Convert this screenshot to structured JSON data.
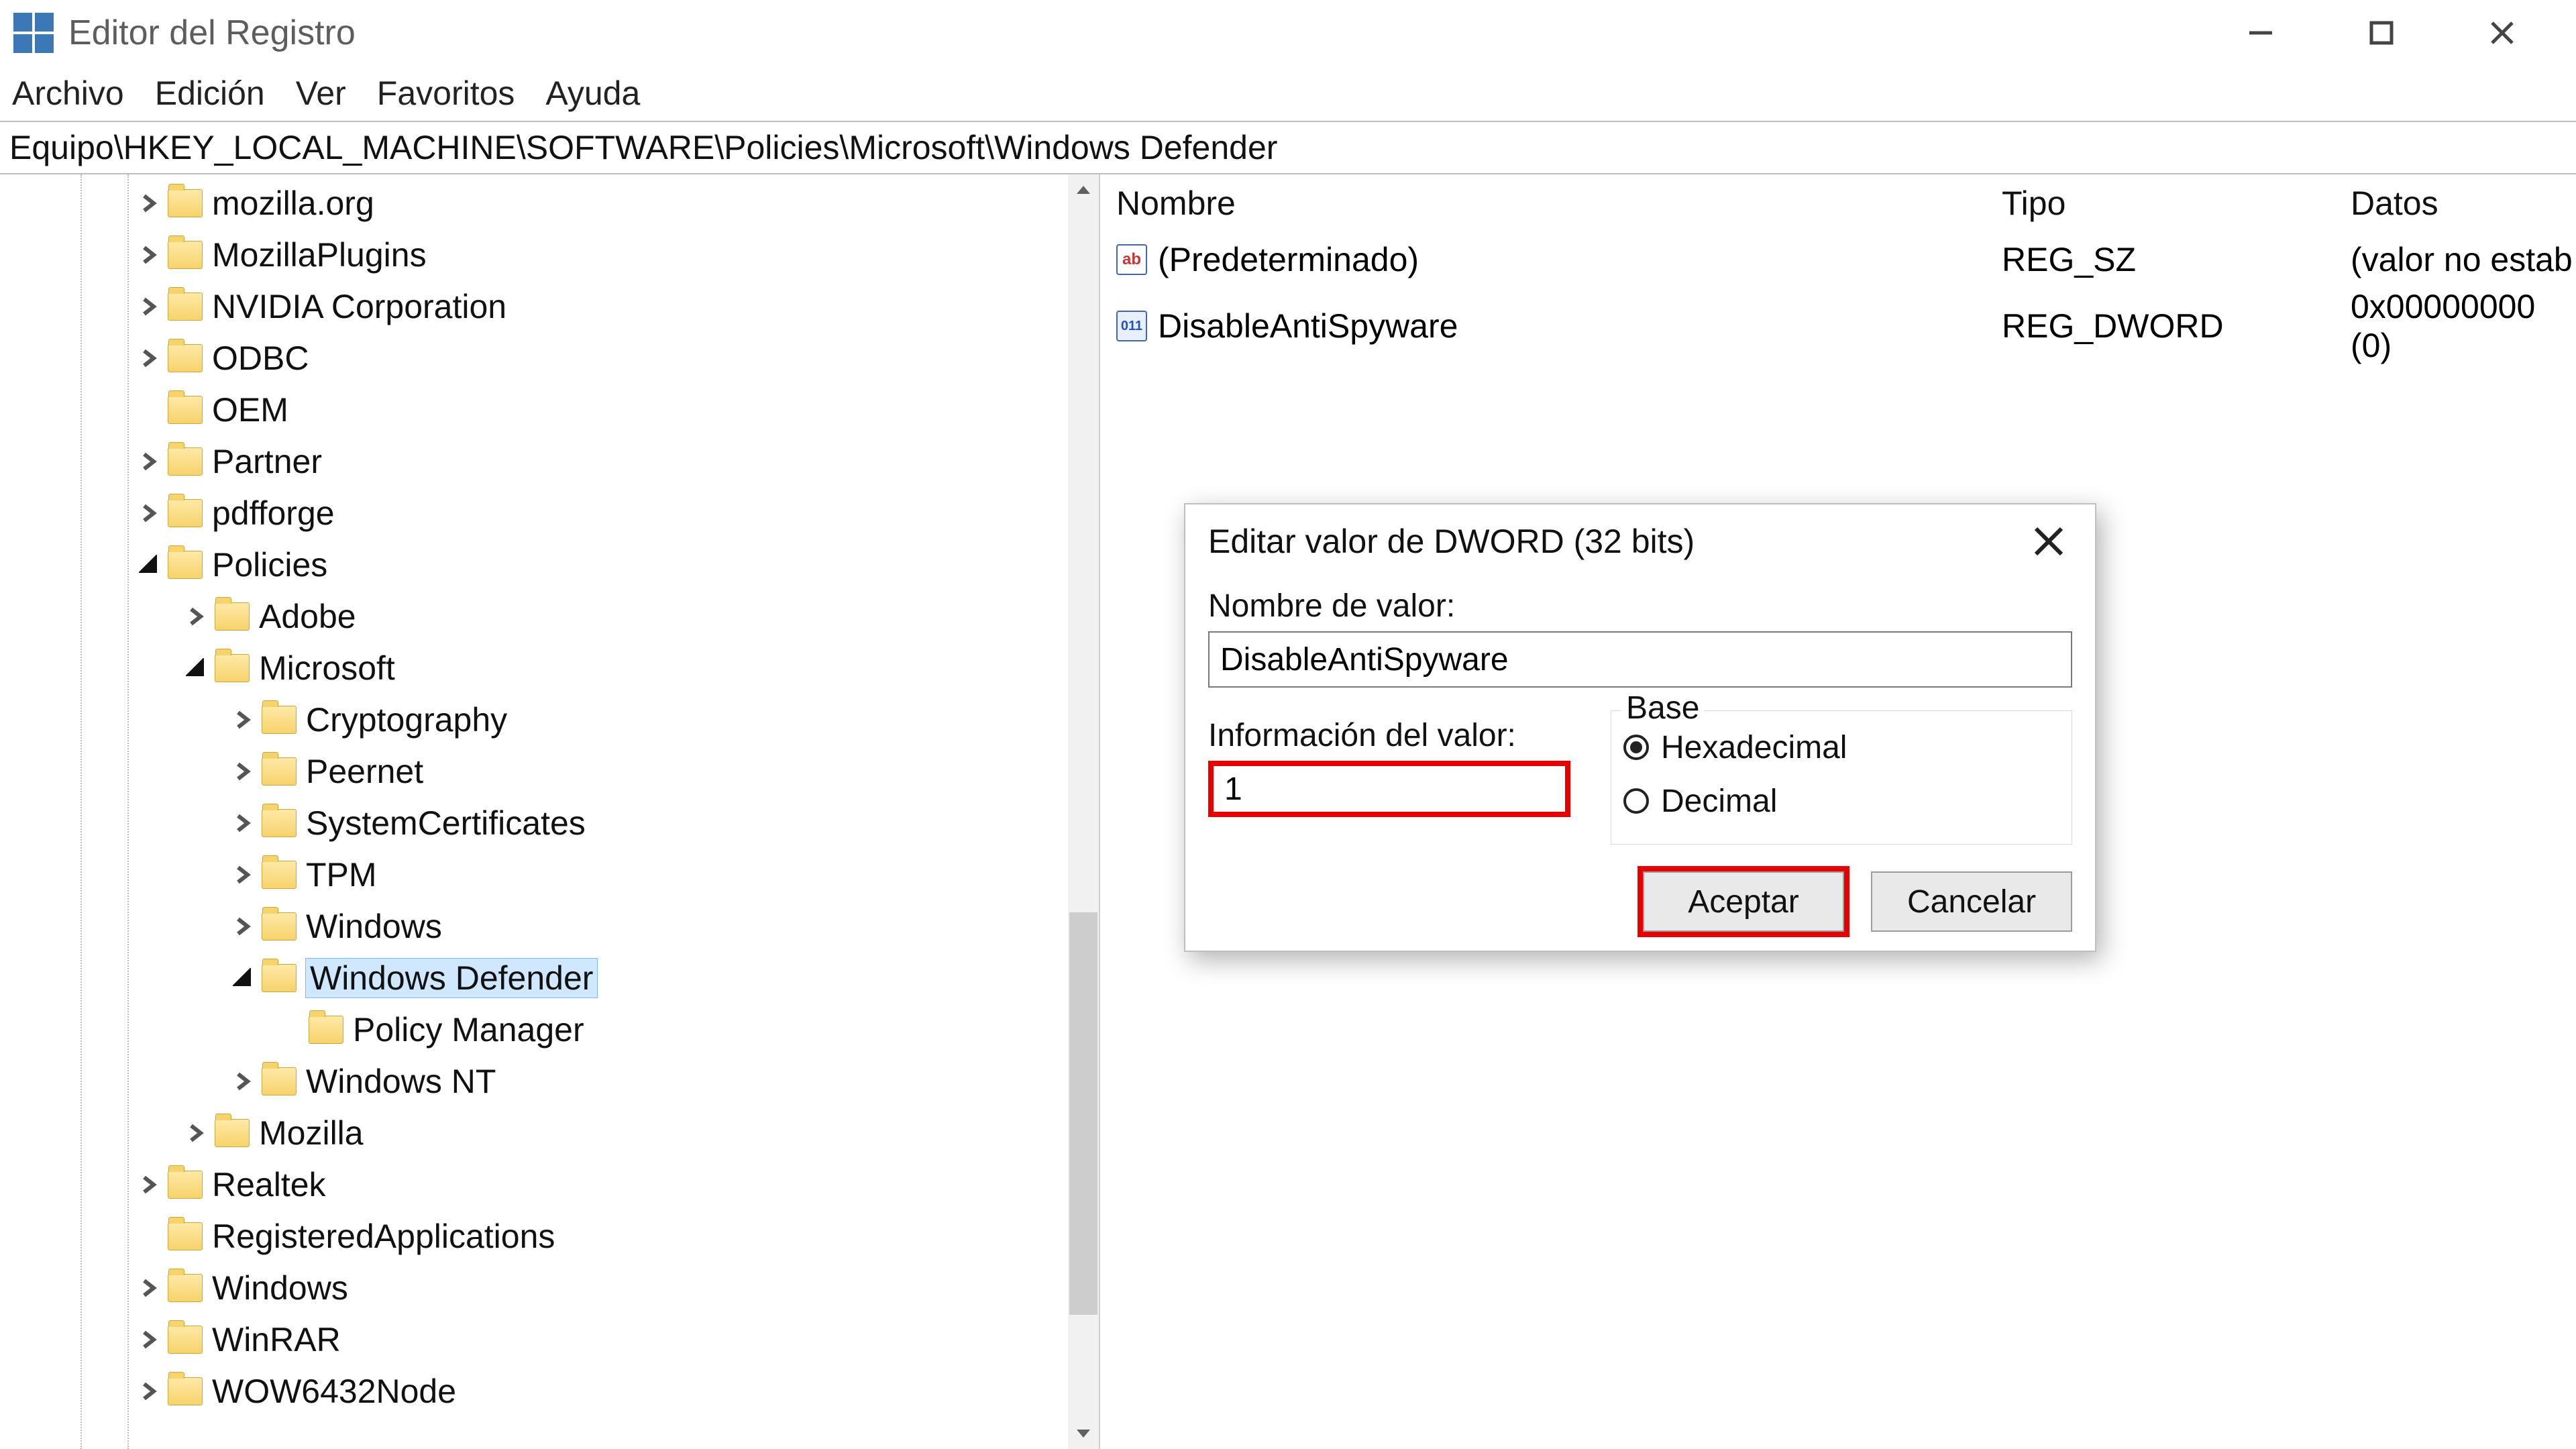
{
  "window": {
    "title": "Editor del Registro"
  },
  "menu": {
    "file": "Archivo",
    "edit": "Edición",
    "view": "Ver",
    "fav": "Favoritos",
    "help": "Ayuda"
  },
  "path": "Equipo\\HKEY_LOCAL_MACHINE\\SOFTWARE\\Policies\\Microsoft\\Windows Defender",
  "tree": [
    {
      "indent": 3,
      "caret": "closed",
      "label": "mozilla.org"
    },
    {
      "indent": 3,
      "caret": "closed",
      "label": "MozillaPlugins"
    },
    {
      "indent": 3,
      "caret": "closed",
      "label": "NVIDIA Corporation"
    },
    {
      "indent": 3,
      "caret": "closed",
      "label": "ODBC"
    },
    {
      "indent": 3,
      "caret": "none",
      "label": "OEM"
    },
    {
      "indent": 3,
      "caret": "closed",
      "label": "Partner"
    },
    {
      "indent": 3,
      "caret": "closed",
      "label": "pdfforge"
    },
    {
      "indent": 3,
      "caret": "open",
      "label": "Policies"
    },
    {
      "indent": 4,
      "caret": "closed",
      "label": "Adobe"
    },
    {
      "indent": 4,
      "caret": "open",
      "label": "Microsoft"
    },
    {
      "indent": 5,
      "caret": "closed",
      "label": "Cryptography"
    },
    {
      "indent": 5,
      "caret": "closed",
      "label": "Peernet"
    },
    {
      "indent": 5,
      "caret": "closed",
      "label": "SystemCertificates"
    },
    {
      "indent": 5,
      "caret": "closed",
      "label": "TPM"
    },
    {
      "indent": 5,
      "caret": "closed",
      "label": "Windows"
    },
    {
      "indent": 5,
      "caret": "open",
      "label": "Windows Defender",
      "selected": true
    },
    {
      "indent": 6,
      "caret": "none",
      "label": "Policy Manager"
    },
    {
      "indent": 5,
      "caret": "closed",
      "label": "Windows NT"
    },
    {
      "indent": 4,
      "caret": "closed",
      "label": "Mozilla"
    },
    {
      "indent": 3,
      "caret": "closed",
      "label": "Realtek"
    },
    {
      "indent": 3,
      "caret": "none",
      "label": "RegisteredApplications"
    },
    {
      "indent": 3,
      "caret": "closed",
      "label": "Windows"
    },
    {
      "indent": 3,
      "caret": "closed",
      "label": "WinRAR"
    },
    {
      "indent": 3,
      "caret": "closed",
      "label": "WOW6432Node"
    }
  ],
  "list": {
    "columns": {
      "name": "Nombre",
      "type": "Tipo",
      "data": "Datos"
    },
    "rows": [
      {
        "icon": "ab",
        "name": "(Predeterminado)",
        "type": "REG_SZ",
        "data": "(valor no estab"
      },
      {
        "icon": "dword",
        "name": "DisableAntiSpyware",
        "type": "REG_DWORD",
        "data": "0x00000000 (0)"
      }
    ]
  },
  "dialog": {
    "title": "Editar valor de DWORD (32 bits)",
    "name_label": "Nombre de valor:",
    "name_value": "DisableAntiSpyware",
    "data_label": "Información del valor:",
    "data_value": "1",
    "base_label": "Base",
    "hex_label": "Hexadecimal",
    "dec_label": "Decimal",
    "ok": "Aceptar",
    "cancel": "Cancelar"
  }
}
